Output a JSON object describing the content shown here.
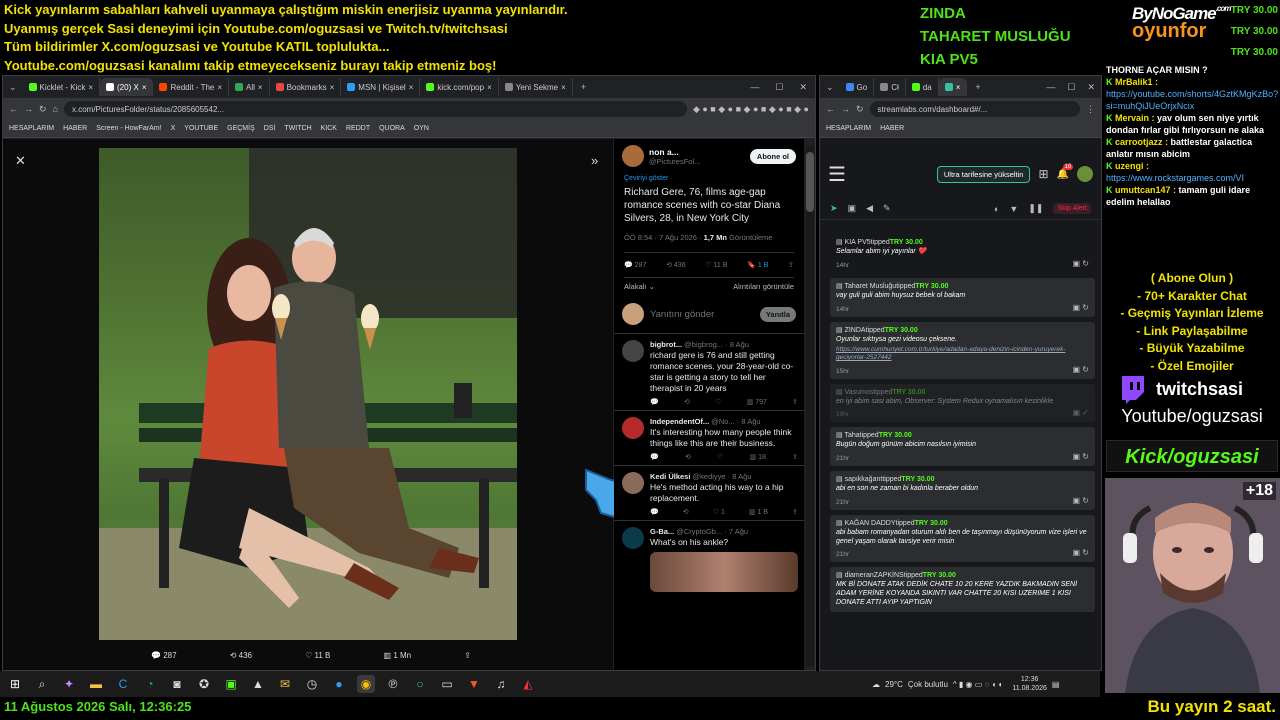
{
  "overlay": {
    "ticker": [
      "Kick yayınlarım sabahları kahveli uyanmaya çalıştığım miskin enerjisiz uyanma yayınlarıdır.",
      "Uyanmış gerçek Sasi deneyimi için Youtube.com/oguzsasi ve Twitch.tv/twitchsasi",
      "Tüm bildirimler X.com/oguzsasi ve Youtube KATIL toplulukta...",
      "Youtube.com/oguzsasi kanalımı takip etmeyecekseniz burayı takip etmeniz boş!"
    ],
    "donors": [
      "ZINDA",
      "TAHARET MUSLUĞU",
      "KIA PV5"
    ],
    "brand_top": "ByNoGame",
    "brand_small": ".com",
    "brand_bottom": "oyunfor",
    "tries": [
      "TRY 30.00",
      "TRY 30.00",
      "TRY 30.00"
    ],
    "footer_date": "11 Ağustos 2026 Salı, 12:36:25",
    "footer_right": "Bu yayın 2 saat.",
    "promo": [
      "( Abone Olun )",
      "- 70+ Karakter Chat",
      "- Geçmiş Yayınları İzleme",
      "- Link Paylaşabilme",
      "- Büyük Yazabilme",
      "- Özel Emojiler"
    ],
    "twitch_name": "twitchsasi",
    "youtube_name": "Youtube/oguzsasi",
    "kick_name": "Kick/oguzsasi",
    "plus_count": "+18",
    "colors": {
      "yellow": "#f2e300",
      "green": "#4ee21a",
      "kick": "#53fc18"
    }
  },
  "chat": [
    {
      "user": "",
      "text": "THORNE AÇAR MISIN ?"
    },
    {
      "user": "MrBalik1 :",
      "text": "",
      "link": "https://youtube.com/shorts/4GztKMgKzBo?si=muhQiJUeOrjxNcix"
    },
    {
      "user": "Mervain :",
      "text": "yav olum sen niye yırtık dondan fırlar gibi fırlıyorsun ne alaka"
    },
    {
      "user": "carrootjazz :",
      "text": "battlestar galactica anlatır mısın abicim"
    },
    {
      "user": "uzengi :",
      "text": "",
      "link": "https://www.rockstargames.com/VI"
    },
    {
      "user": "umuttcan147 :",
      "text": "tamam guli idare edelim helallao"
    }
  ],
  "browser_left": {
    "tabs": [
      "Kicklet - Kick",
      "(20) X",
      "Reddit - The",
      "All",
      "Bookmarks",
      "MSN | Kişisel",
      "kick.com/pop",
      "Yeni Sekme"
    ],
    "url": "x.com/PicturesFolder/status/2085605542...",
    "bookmarks": [
      "HESAPLARIM",
      "HABER",
      "Screen - HowFarAm!",
      "X",
      "YOUTUBE",
      "GEÇMİŞ",
      "DSİ",
      "TWITCH",
      "KICK",
      "REDDT",
      "QUORA",
      "OYN"
    ],
    "media_actions": {
      "replies": "287",
      "reposts": "436",
      "likes": "11 B",
      "views": "1 Mn"
    }
  },
  "post": {
    "author": "non a...",
    "handle": "@PicturesFol...",
    "follow": "Abone ol",
    "translate": "Çeviriyi göster",
    "text": "Richard Gere, 76, films age-gap romance scenes with co-star Diana Silvers, 28, in New York City",
    "time": "ÖÖ 8:54 · 7 Ağu 2026 ·",
    "views_bold": "1,7 Mn",
    "views_label": "Görüntüleme",
    "stats": {
      "replies": "287",
      "reposts": "436",
      "likes": "11 B",
      "bookmarks": "1 B"
    },
    "sort_label": "Alakalı",
    "quotes_label": "Alıntıları görüntüle",
    "reply_placeholder": "Yanıtını gönder",
    "reply_button": "Yanıtla"
  },
  "replies": [
    {
      "name": "bigbrot...",
      "handle": "@bigbrog...",
      "date": "· 8 Ağu",
      "text": "richard gere is 76 and still getting romance scenes. your 28-year-old co-star is getting a story to tell her therapist in 20 years",
      "views": "797"
    },
    {
      "name": "IndependentOf...",
      "handle": "@No...",
      "date": "· 8 Ağu",
      "text": "It's interesting how many people think things like this are their business.",
      "views": "18"
    },
    {
      "name": "Kedi Ülkesi",
      "handle": "@kediyye",
      "date": "· 8 Ağu",
      "text": "He's method acting his way to a hip replacement.",
      "likes": "1",
      "views": "1 B"
    },
    {
      "name": "G-Ba...",
      "handle": "@CryptoGb...",
      "date": "· 7 Ağu",
      "text": "What's on his ankle?"
    }
  ],
  "browser_right": {
    "url": "streamlabs.com/dashboard#/...",
    "bookmarks": [
      "HESAPLARIM",
      "HABER"
    ],
    "upgrade": "Ultra tarifesine yükseltin",
    "skip": "Skip Alert",
    "badge": "10"
  },
  "tips": [
    {
      "name": "KIA PV5",
      "verb": "tipped",
      "amount": "TRY 30.00",
      "msg": "Selamlar abim iyi yayınlar ❤️",
      "time": "14hr"
    },
    {
      "name": "Taharet Musluğu",
      "verb": "tipped",
      "amount": "TRY 30.00",
      "msg": "vay guli guli abim huysuz bebek ol bakam",
      "time": "14hr"
    },
    {
      "name": "ZINDA",
      "verb": "tipped",
      "amount": "TRY 30.00",
      "msg": "Oyunlar sıktıysa gezi videosu çeksene.",
      "link": "https://www.cumhuriyet.com.tr/turkiye/adadan-adaya-denizin-icinden-yuruyerek-geciyorlar-2527442",
      "time": "15hr"
    },
    {
      "name": "Vasumos",
      "verb": "tipped",
      "amount": "TRY 30.00",
      "msg": "en iyi abim sasi abim, Observer: System Redux oynamalısın kesinlikle",
      "time": "19hr",
      "dim": true
    },
    {
      "name": "Taha",
      "verb": "tipped",
      "amount": "TRY 30.00",
      "msg": "Bugün doğum günüm abicim nasılsın iyimisin",
      "time": "21hr"
    },
    {
      "name": "sapıkkağant",
      "verb": "tipped",
      "amount": "TRY 30.00",
      "msg": "abi en son ne zaman bi kadınla beraber oldun",
      "time": "21hr"
    },
    {
      "name": "KAĞAN DADDY",
      "verb": "tipped",
      "amount": "TRY 30.00",
      "msg": "abi babam romanyadan oturum aldı ben de taşınmayı düşünüyorum vize işleri ve genel yaşam olarak tavsiye verir misin",
      "time": "21hr"
    },
    {
      "name": "diameranZAPKİNS",
      "verb": "tipped",
      "amount": "TRY 30.00",
      "msg": "MK Bİ DONATE ATAK DEDİK CHATE 10 20 KERE YAZDIK BAKMADIN SENİ ADAM YERİNE KOYANDA SIKINTI VAR CHATTE 20 KISI UZERIME 1 KISI DONATE ATTI AYIP YAPTIGIN",
      "time": ""
    }
  ],
  "taskbar": {
    "weather": "29°C",
    "weather_label": "Çok bulutlu",
    "time": "12:36",
    "date": "11.08.2026"
  }
}
